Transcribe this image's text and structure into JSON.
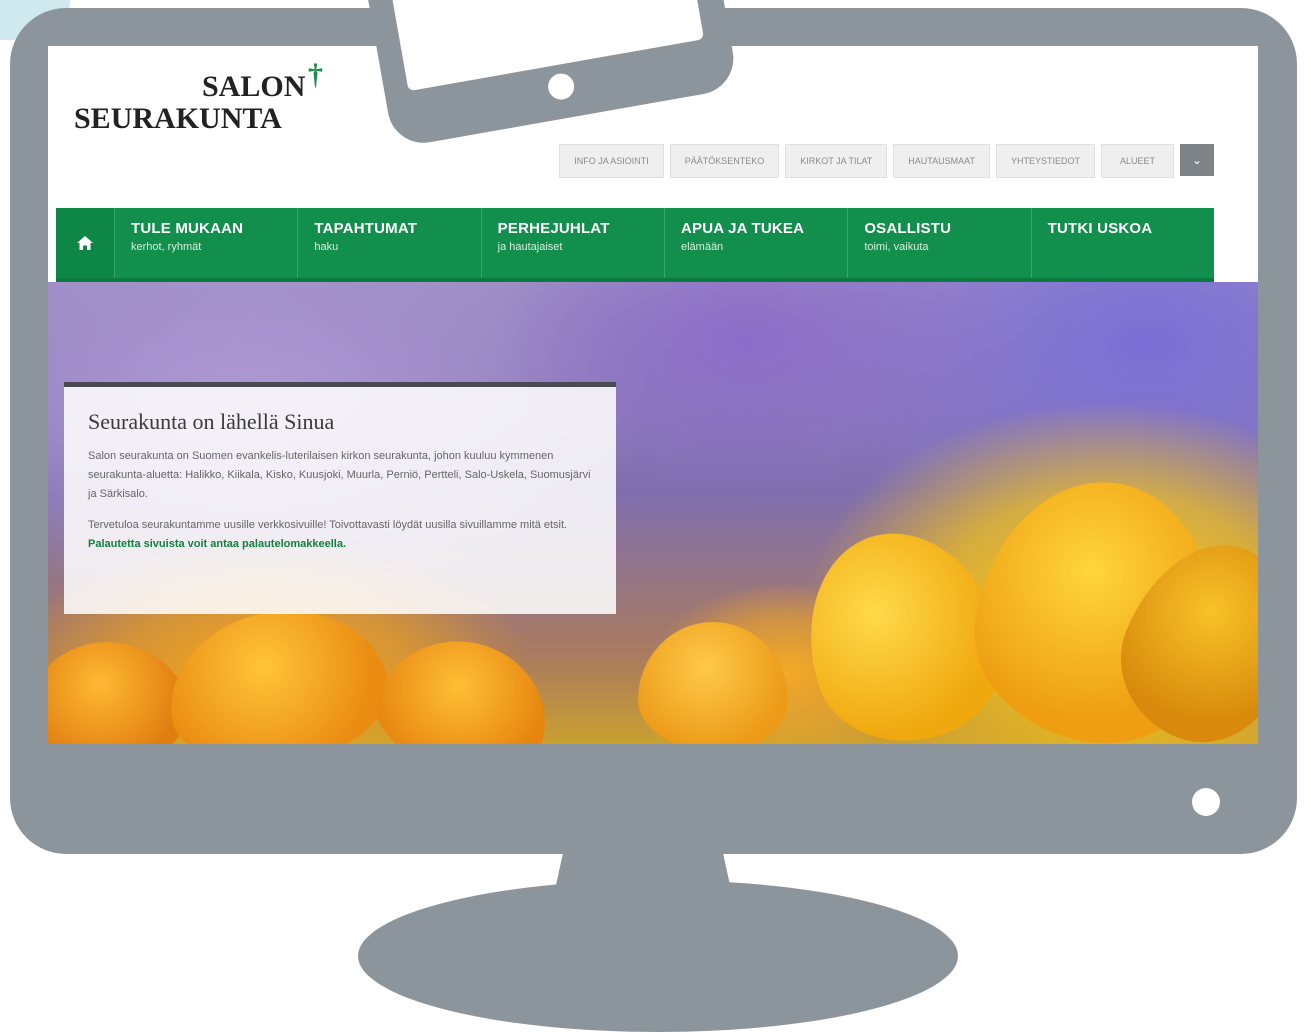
{
  "logo": {
    "line1": "SALON",
    "line2": "SEURAKUNTA",
    "cross": "†"
  },
  "util_nav": {
    "items": [
      "INFO JA ASIOINTI",
      "PÄÄTÖKSENTEKO",
      "KIRKOT JA TILAT",
      "HAUTAUSMAAT",
      "YHTEYSTIEDOT"
    ],
    "areas_label": "ALUEET",
    "toggle_icon": "⌄"
  },
  "main_nav": {
    "home_icon": "home-icon",
    "items": [
      {
        "title": "TULE MUKAAN",
        "sub": "kerhot, ryhmät"
      },
      {
        "title": "TAPAHTUMAT",
        "sub": "haku"
      },
      {
        "title": "PERHEJUHLAT",
        "sub": "ja hautajaiset"
      },
      {
        "title": "APUA JA TUKEA",
        "sub": "elämään"
      },
      {
        "title": "OSALLISTU",
        "sub": "toimi, vaikuta"
      },
      {
        "title": "TUTKI USKOA",
        "sub": ""
      }
    ]
  },
  "hero": {
    "title": "Seurakunta on lähellä Sinua",
    "p1": "Salon seurakunta on Suomen evankelis-luterilaisen kirkon seurakunta, johon kuuluu kymmenen seurakunta-aluetta: Halikko, Kiikala, Kisko, Kuusjoki, Muurla, Perniö, Pertteli, Salo-Uskela, Suomusjärvi ja Särkisalo.",
    "p2": "Tervetuloa seurakuntamme uusille verkkosivuille! Toivottavasti löydät uusilla sivuillamme mitä etsit.",
    "link": "Palautetta sivuista voit antaa palautelomakkeella."
  },
  "colors": {
    "nav_green": "#128f4c",
    "frame_gray": "#8d959c",
    "link_green": "#13803f"
  }
}
